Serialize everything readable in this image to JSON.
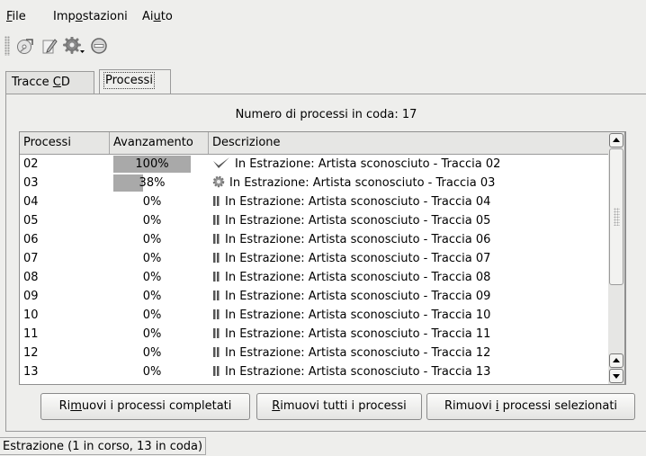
{
  "menubar": {
    "items": [
      {
        "pre": "",
        "key": "F",
        "post": "ile"
      },
      {
        "pre": "Imp",
        "key": "o",
        "post": "stazioni"
      },
      {
        "pre": "Ai",
        "key": "u",
        "post": "to"
      }
    ]
  },
  "toolbar": {
    "icons": [
      "rip-cd-icon",
      "edit-icon",
      "settings-gear-icon",
      "stop-icon"
    ]
  },
  "tabs": [
    {
      "pre": "Tracce ",
      "key": "C",
      "post": "D",
      "active": false
    },
    {
      "pre": "Processi",
      "key": "",
      "post": "",
      "active": true
    }
  ],
  "queue_info": "Numero di processi in coda: 17",
  "table": {
    "columns": [
      "Processi",
      "Avanzamento",
      "Descrizione"
    ],
    "rows": [
      {
        "id": "02",
        "progress": 100,
        "progress_label": "100%",
        "status": "done",
        "description": "In Estrazione: Artista sconosciuto - Traccia 02"
      },
      {
        "id": "03",
        "progress": 38,
        "progress_label": "38%",
        "status": "running",
        "description": "In Estrazione: Artista sconosciuto - Traccia 03"
      },
      {
        "id": "04",
        "progress": 0,
        "progress_label": "0%",
        "status": "paused",
        "description": "In Estrazione: Artista sconosciuto - Traccia 04"
      },
      {
        "id": "05",
        "progress": 0,
        "progress_label": "0%",
        "status": "paused",
        "description": "In Estrazione: Artista sconosciuto - Traccia 05"
      },
      {
        "id": "06",
        "progress": 0,
        "progress_label": "0%",
        "status": "paused",
        "description": "In Estrazione: Artista sconosciuto - Traccia 06"
      },
      {
        "id": "07",
        "progress": 0,
        "progress_label": "0%",
        "status": "paused",
        "description": "In Estrazione: Artista sconosciuto - Traccia 07"
      },
      {
        "id": "08",
        "progress": 0,
        "progress_label": "0%",
        "status": "paused",
        "description": "In Estrazione: Artista sconosciuto - Traccia 08"
      },
      {
        "id": "09",
        "progress": 0,
        "progress_label": "0%",
        "status": "paused",
        "description": "In Estrazione: Artista sconosciuto - Traccia 09"
      },
      {
        "id": "10",
        "progress": 0,
        "progress_label": "0%",
        "status": "paused",
        "description": "In Estrazione: Artista sconosciuto - Traccia 10"
      },
      {
        "id": "11",
        "progress": 0,
        "progress_label": "0%",
        "status": "paused",
        "description": "In Estrazione: Artista sconosciuto - Traccia 11"
      },
      {
        "id": "12",
        "progress": 0,
        "progress_label": "0%",
        "status": "paused",
        "description": "In Estrazione: Artista sconosciuto - Traccia 12"
      },
      {
        "id": "13",
        "progress": 0,
        "progress_label": "0%",
        "status": "paused",
        "description": "In Estrazione: Artista sconosciuto - Traccia 13"
      }
    ]
  },
  "buttons": [
    {
      "name": "remove-completed-button",
      "pre": "Ri",
      "key": "m",
      "post": "uovi i processi completati"
    },
    {
      "name": "remove-all-button",
      "pre": "",
      "key": "R",
      "post": "imuovi tutti i processi"
    },
    {
      "name": "remove-selected-button",
      "pre": "Rimuovi ",
      "key": "i",
      "post": " processi selezionati"
    }
  ],
  "statusbar": {
    "text": "Estrazione (1 in corso, 13 in coda)"
  },
  "colors": {
    "progress_fill": "#a9a9a9",
    "check": "#555555",
    "pause": "#555555"
  }
}
